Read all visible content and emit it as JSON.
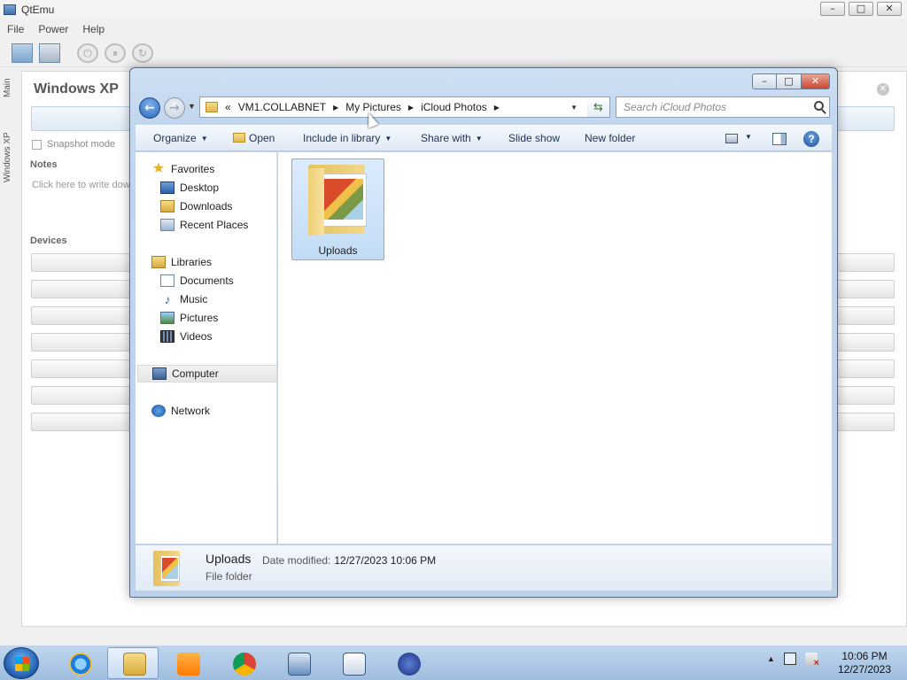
{
  "qtemu": {
    "title": "QtEmu",
    "menu": [
      "File",
      "Power",
      "Help"
    ],
    "side_tabs": [
      "Main",
      "Windows XP"
    ],
    "vm_name": "Windows XP",
    "snapshot_label": "Snapshot mode",
    "notes_heading": "Notes",
    "notes_placeholder": "Click here to write dow",
    "devices_heading": "Devices"
  },
  "explorer": {
    "breadcrumb": [
      "«",
      "VM1.COLLABNET",
      "My Pictures",
      "iCloud Photos"
    ],
    "search_placeholder": "Search iCloud Photos",
    "toolbar": {
      "organize": "Organize",
      "open": "Open",
      "include_in_library": "Include in library",
      "share_with": "Share with",
      "slide_show": "Slide show",
      "new_folder": "New folder"
    },
    "nav": {
      "favorites": "Favorites",
      "desktop": "Desktop",
      "downloads": "Downloads",
      "recent_places": "Recent Places",
      "libraries": "Libraries",
      "documents": "Documents",
      "music": "Music",
      "pictures": "Pictures",
      "videos": "Videos",
      "computer": "Computer",
      "network": "Network"
    },
    "files": [
      {
        "name": "Uploads",
        "icon": "picture-folder-icon",
        "selected": true
      }
    ],
    "details": {
      "name": "Uploads",
      "modified_label": "Date modified:",
      "modified_value": "12/27/2023 10:06 PM",
      "type": "File folder"
    }
  },
  "taskbar": {
    "pinned": [
      "internet-explorer-icon",
      "windows-explorer-icon",
      "media-player-icon",
      "chrome-icon",
      "remote-desktop-icon",
      "document-icon",
      "virtualbox-icon"
    ],
    "active": "windows-explorer-icon",
    "clock_time": "10:06 PM",
    "clock_date": "12/27/2023"
  }
}
